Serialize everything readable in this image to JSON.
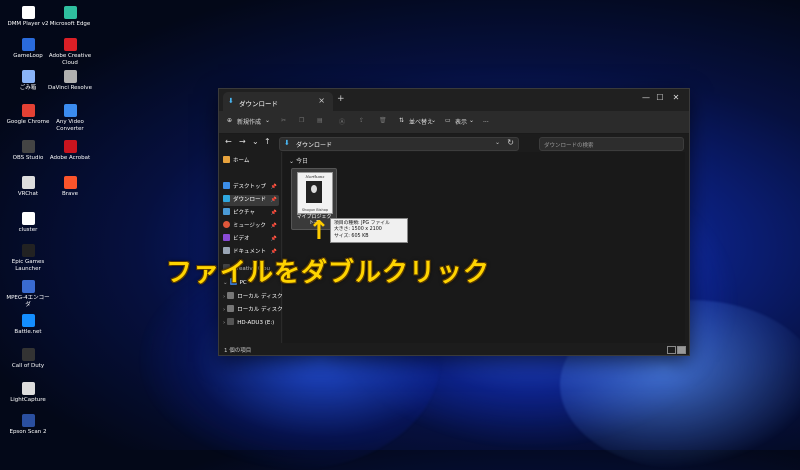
{
  "desktop": {
    "icons": [
      {
        "label": "DMM Player v2",
        "color": "#ffffff"
      },
      {
        "label": "Microsoft Edge",
        "color": "#2fbf9f"
      },
      {
        "label": "GameLoop",
        "color": "#2a6bdc"
      },
      {
        "label": "Adobe Creative Cloud",
        "color": "#da1f26"
      },
      {
        "label": "ごみ箱",
        "color": "#8ab4f8"
      },
      {
        "label": "DaVinci Resolve",
        "color": "#b0b0b0"
      },
      {
        "label": "Google Chrome",
        "color": "#e44134"
      },
      {
        "label": "Any Video Converter",
        "color": "#3b8cf0"
      },
      {
        "label": "OBS Studio",
        "color": "#444444"
      },
      {
        "label": "Adobe Acrobat",
        "color": "#c9141e"
      },
      {
        "label": "VRChat",
        "color": "#dddddd"
      },
      {
        "label": "Brave",
        "color": "#fb542b"
      },
      {
        "label": "cluster",
        "color": "#ffffff"
      },
      {
        "label": "Epic Games Launcher",
        "color": "#222222"
      },
      {
        "label": "MPEG-4エンコーダ",
        "color": "#3a6bd0"
      },
      {
        "label": "Battle.net",
        "color": "#148eff"
      },
      {
        "label": "Call of Duty",
        "color": "#333333"
      },
      {
        "label": "LightCapture",
        "color": "#dddddd"
      },
      {
        "label": "Epson Scan 2",
        "color": "#2a4fa0"
      }
    ]
  },
  "window": {
    "tab_title": "ダウンロード",
    "toolbar": {
      "new_label": "新規作成",
      "sort_label": "並べ替え",
      "view_label": "表示",
      "more_label": "..."
    },
    "address_text": "ダウンロード",
    "search_placeholder": "ダウンロードの検索",
    "sidebar": {
      "home": "ホーム",
      "desktop": "デスクトップ",
      "downloads": "ダウンロード",
      "pictures": "ピクチャ",
      "music": "ミュージック",
      "videos": "ビデオ",
      "documents": "ドキュメント",
      "creative_cloud": "Creative Clou",
      "pc": "PC",
      "local_disk_1": "ローカル ディスク",
      "local_disk_2": "ローカル ディスク",
      "hd_drive": "HD-ADU3 (E:)"
    },
    "group_label": "今日",
    "file": {
      "thumbnail_title": "Northanz",
      "thumbnail_author": "Shogun Bishop",
      "name": "マイプロジェクト-1"
    },
    "tooltip": {
      "type": "項目の種類: JPG ファイル",
      "dimensions": "大きさ: 1500 x 2100",
      "size": "サイズ: 605 KB"
    },
    "status_text": "1 個の項目"
  },
  "annotation": {
    "arrow": "↑",
    "text": "ファイルをダブルクリック",
    "color": "#ffd400"
  }
}
